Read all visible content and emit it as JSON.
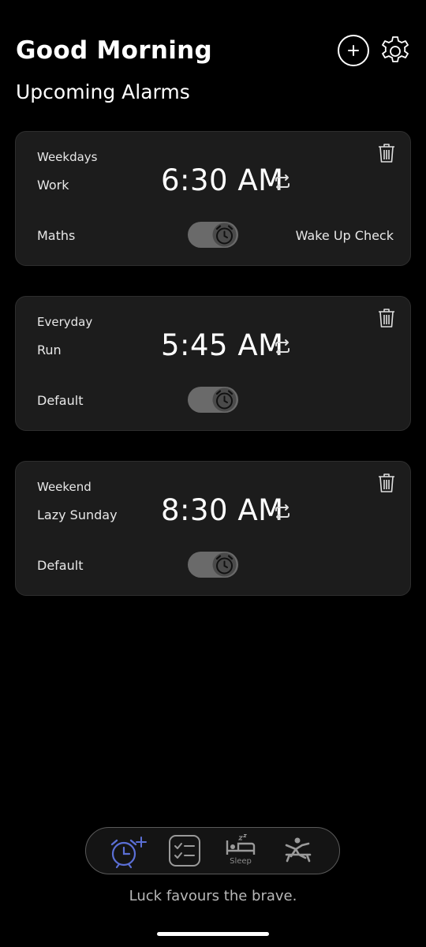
{
  "header": {
    "greeting": "Good Morning",
    "add_icon": "plus-circle-icon",
    "settings_icon": "gear-icon"
  },
  "section_title": "Upcoming Alarms",
  "alarms": [
    {
      "days": "Weekdays",
      "label": "Work",
      "time": "6:30 AM",
      "mission": "Maths",
      "wake_up_check": "Wake Up Check",
      "enabled": true
    },
    {
      "days": "Everyday",
      "label": "Run",
      "time": "5:45 AM",
      "mission": "Default",
      "wake_up_check": "",
      "enabled": true
    },
    {
      "days": "Weekend",
      "label": "Lazy Sunday",
      "time": "8:30 AM",
      "mission": "Default",
      "wake_up_check": "",
      "enabled": true
    }
  ],
  "bottom_nav": {
    "items": [
      {
        "icon": "alarm-add-icon",
        "label": "",
        "active": true
      },
      {
        "icon": "checklist-icon",
        "label": "",
        "active": false
      },
      {
        "icon": "sleep-bed-icon",
        "label": "Sleep",
        "active": false
      },
      {
        "icon": "exercise-icon",
        "label": "",
        "active": false
      }
    ]
  },
  "quote": "Luck favours the brave.",
  "colors": {
    "background": "#000000",
    "card": "#1c1c1c",
    "accent": "#5b6fd6",
    "toggle": "#6a6a6a"
  }
}
